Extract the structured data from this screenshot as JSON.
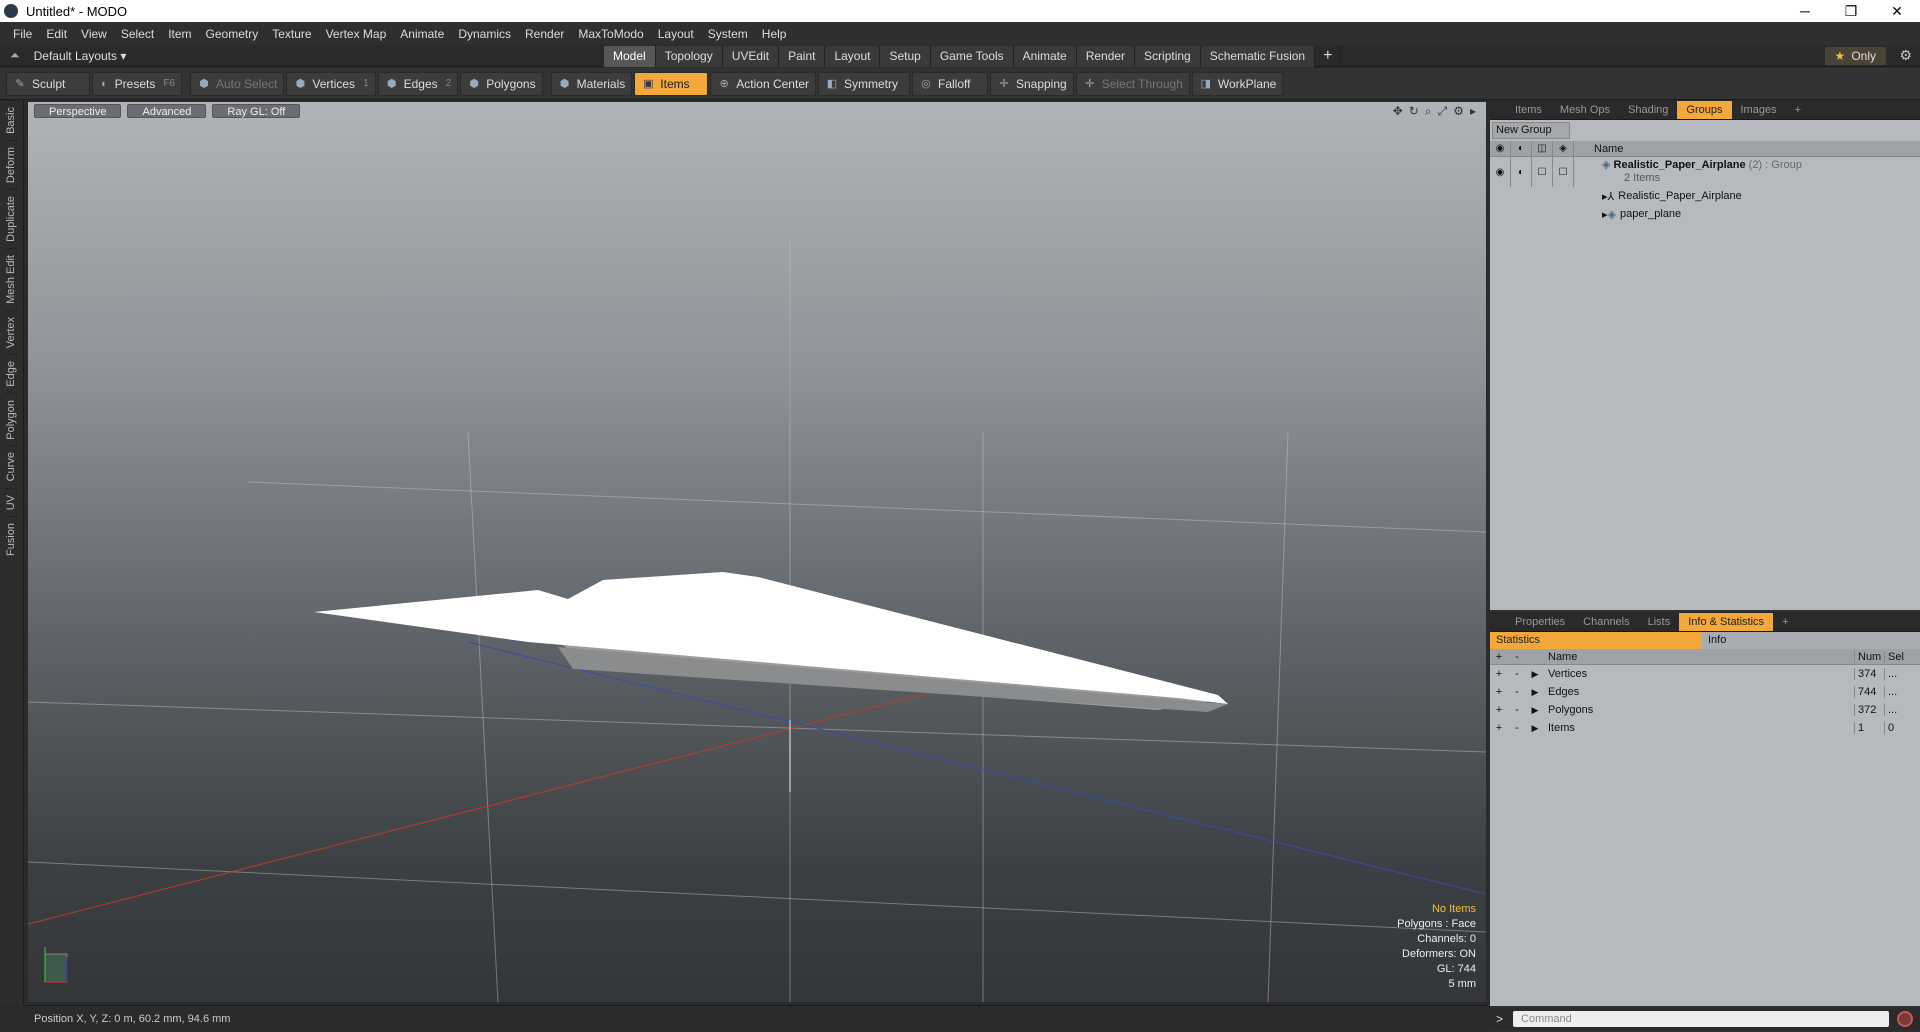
{
  "window": {
    "title": "Untitled* - MODO",
    "minimize": "─",
    "maximize": "❐",
    "close": "✕"
  },
  "menu": [
    "File",
    "Edit",
    "View",
    "Select",
    "Item",
    "Geometry",
    "Texture",
    "Vertex Map",
    "Animate",
    "Dynamics",
    "Render",
    "MaxToModo",
    "Layout",
    "System",
    "Help"
  ],
  "layout": {
    "name": "Default Layouts ▾",
    "tabs": [
      "Model",
      "Topology",
      "UVEdit",
      "Paint",
      "Layout",
      "Setup",
      "Game Tools",
      "Animate",
      "Render",
      "Scripting",
      "Schematic Fusion"
    ],
    "active_tab": "Model",
    "add_tab": "+",
    "only_star": "★",
    "only_label": "Only",
    "gear": "⚙"
  },
  "toolbar": {
    "sculpt": "Sculpt",
    "presets": "Presets",
    "presets_key": "F6",
    "auto_select": "Auto Select",
    "vertices": "Vertices",
    "vertices_key": "1",
    "edges": "Edges",
    "edges_key": "2",
    "polygons": "Polygons",
    "materials": "Materials",
    "items": "Items",
    "action_center": "Action Center",
    "symmetry": "Symmetry",
    "falloff": "Falloff",
    "snapping": "Snapping",
    "select_through": "Select Through",
    "workplane": "WorkPlane"
  },
  "left_tabs": [
    "Basic",
    "Deform",
    "Duplicate",
    "Mesh Edit",
    "Vertex",
    "Edge",
    "Polygon",
    "Curve",
    "UV",
    "Fusion"
  ],
  "viewport": {
    "view": "Perspective",
    "shading": "Advanced",
    "raygl": "Ray GL: Off",
    "info": {
      "no_items": "No Items",
      "polygons": "Polygons : Face",
      "channels": "Channels: 0",
      "deformers": "Deformers: ON",
      "gl": "GL: 744",
      "unit": "5 mm"
    }
  },
  "status": {
    "position": "Position X, Y, Z:  0 m, 60.2 mm, 94.6 mm"
  },
  "top_panel": {
    "tabs": [
      "Items",
      "Mesh Ops",
      "Shading",
      "Groups",
      "Images",
      "+"
    ],
    "active_tab": "Groups",
    "new_group": "New Group",
    "col_name": "Name",
    "group": {
      "name": "Realistic_Paper_Airplane",
      "count": "(2)",
      "type": ": Group",
      "sub": "2 Items"
    },
    "children": [
      "Realistic_Paper_Airplane",
      "paper_plane"
    ]
  },
  "bottom_panel": {
    "tabs": [
      "Properties",
      "Channels",
      "Lists",
      "Info & Statistics",
      "+"
    ],
    "active_tab": "Info & Statistics",
    "subtabs": [
      "Statistics",
      "Info"
    ],
    "headers": {
      "name": "Name",
      "num": "Num",
      "sel": "Sel"
    },
    "rows": [
      {
        "name": "Vertices",
        "num": "374",
        "sel": "..."
      },
      {
        "name": "Edges",
        "num": "744",
        "sel": "..."
      },
      {
        "name": "Polygons",
        "num": "372",
        "sel": "..."
      },
      {
        "name": "Items",
        "num": "1",
        "sel": "0"
      }
    ]
  },
  "command": {
    "prompt": ">",
    "placeholder": "Command"
  }
}
